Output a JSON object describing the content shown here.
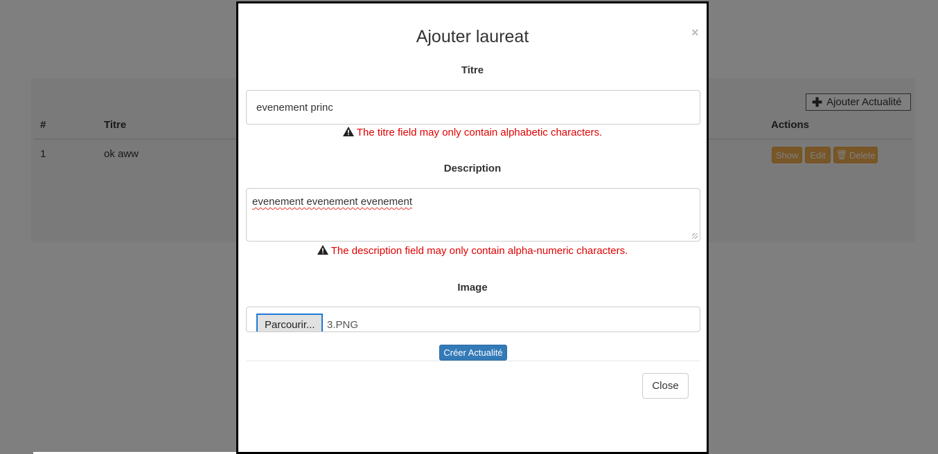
{
  "background": {
    "add_button_label": "Ajouter Actualité",
    "table": {
      "headers": {
        "num": "#",
        "titre": "Titre",
        "actions": "Actions"
      },
      "rows": [
        {
          "num": "1",
          "titre": "ok aww"
        }
      ]
    },
    "row_actions": {
      "show": "Show",
      "edit": "Edit",
      "delete": "Delete"
    }
  },
  "modal": {
    "title": "Ajouter laureat",
    "close_symbol": "×",
    "titre": {
      "label": "Titre",
      "value": "evenement princ",
      "error": "The titre field may only contain alphabetic characters."
    },
    "description": {
      "label": "Description",
      "value": "evenement evenement evenement",
      "error": "The description field may only contain alpha-numeric characters."
    },
    "image": {
      "label": "Image",
      "browse_label": "Parcourir...",
      "file_name": "3.PNG"
    },
    "submit_label": "Créer Actualité",
    "close_label": "Close"
  },
  "colors": {
    "error": "#e00000",
    "primary": "#337ab7",
    "warning": "#f0ad4e"
  },
  "icons": {
    "add": "plus-icon",
    "delete": "trash-icon",
    "error": "warning-triangle-icon"
  }
}
